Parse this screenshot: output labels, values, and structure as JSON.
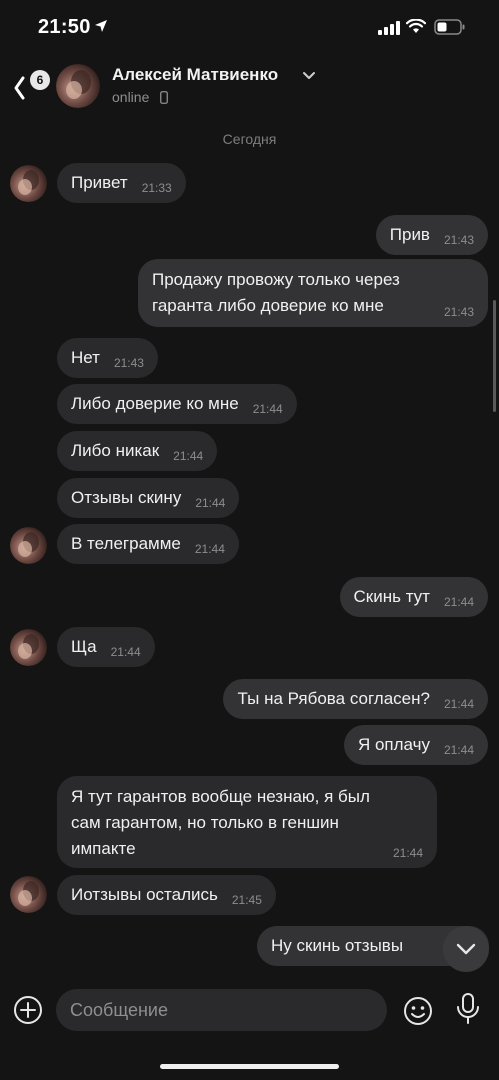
{
  "status_bar": {
    "time": "21:50"
  },
  "header": {
    "badge": "6",
    "name": "Алексей Матвиенко",
    "status": "online"
  },
  "date_separator": "Сегодня",
  "messages": [
    {
      "dir": "in",
      "text": "Привет",
      "time": "21:33"
    },
    {
      "dir": "out",
      "text": "Прив",
      "time": "21:43"
    },
    {
      "dir": "out",
      "text": [
        "Продажу провожу только через",
        "гаранта либо доверие ко мне"
      ],
      "time": "21:43"
    },
    {
      "dir": "in",
      "text": "Нет",
      "time": "21:43"
    },
    {
      "dir": "in",
      "text": "Либо доверие ко мне",
      "time": "21:44"
    },
    {
      "dir": "in",
      "text": "Либо никак",
      "time": "21:44"
    },
    {
      "dir": "in",
      "text": "Отзывы скину",
      "time": "21:44"
    },
    {
      "dir": "in",
      "text": "В телеграмме",
      "time": "21:44"
    },
    {
      "dir": "out",
      "text": "Скинь тут",
      "time": "21:44"
    },
    {
      "dir": "in",
      "text": "Ща",
      "time": "21:44"
    },
    {
      "dir": "out",
      "text": "Ты на Рябова согласен?",
      "time": "21:44"
    },
    {
      "dir": "out",
      "text": "Я оплачу",
      "time": "21:44"
    },
    {
      "dir": "in",
      "text": [
        "Я тут гарантов вообще незнаю, я был",
        "сам гарантом, но только в геншин",
        "импакте"
      ],
      "time": "21:44"
    },
    {
      "dir": "in",
      "text": "Иотзывы остались",
      "time": "21:45"
    },
    {
      "dir": "out",
      "text": "Ну скинь отзывы",
      "time": ""
    }
  ],
  "composer": {
    "placeholder": "Сообщение"
  },
  "colors": {
    "background": "#141414",
    "bubble_in": "#2a2a2c",
    "bubble_out": "#333335",
    "meta": "#8d8d90"
  },
  "icons": [
    "back-chevron-icon",
    "chevron-down-icon",
    "phone-icon",
    "plus-icon",
    "emoji-icon",
    "microphone-icon",
    "scroll-down-icon"
  ]
}
